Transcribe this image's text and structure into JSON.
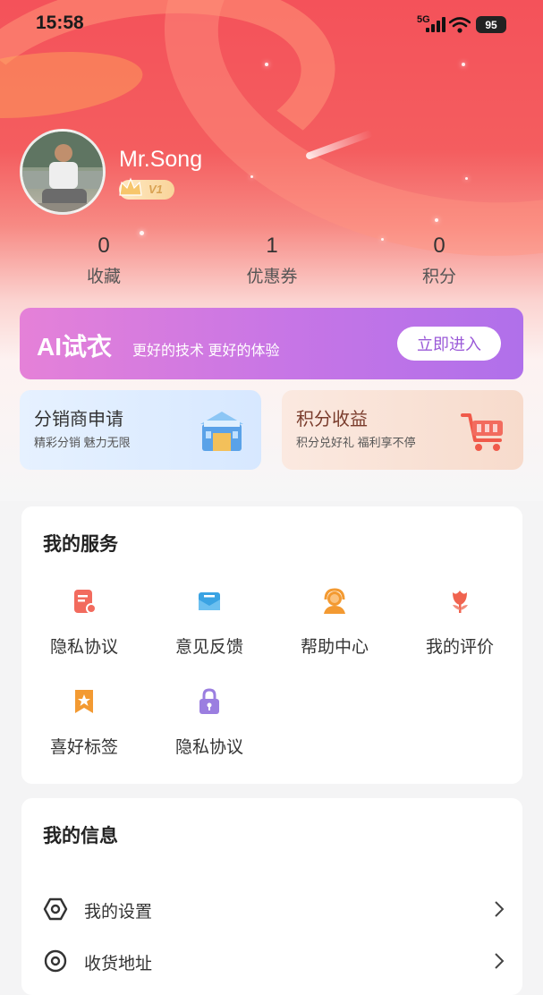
{
  "status_bar": {
    "time": "15:58",
    "network": "5G",
    "battery": "95"
  },
  "profile": {
    "name": "Mr.Song",
    "vip_label": "V1"
  },
  "stats": [
    {
      "value": "0",
      "label": "收藏"
    },
    {
      "value": "1",
      "label": "优惠券"
    },
    {
      "value": "0",
      "label": "积分"
    }
  ],
  "ai_banner": {
    "title": "AI试衣",
    "subtitle": "更好的技术 更好的体验",
    "button": "立即进入"
  },
  "promo_cards": [
    {
      "title": "分销商申请",
      "subtitle": "精彩分销 魅力无限"
    },
    {
      "title": "积分收益",
      "subtitle": "积分兑好礼 福利享不停"
    }
  ],
  "services": {
    "title": "我的服务",
    "items": [
      {
        "label": "隐私协议",
        "icon": "document-icon",
        "color": "#f26b5e"
      },
      {
        "label": "意见反馈",
        "icon": "mail-icon",
        "color": "#3aa3e3"
      },
      {
        "label": "帮助中心",
        "icon": "headset-icon",
        "color": "#f39a32"
      },
      {
        "label": "我的评价",
        "icon": "flower-icon",
        "color": "#f0634f"
      },
      {
        "label": "喜好标签",
        "icon": "bookmark-icon",
        "color": "#f39a32"
      },
      {
        "label": "隐私协议",
        "icon": "lock-icon",
        "color": "#9b7ee0"
      }
    ]
  },
  "info": {
    "title": "我的信息",
    "items": [
      {
        "label": "我的设置",
        "icon": "settings-icon"
      },
      {
        "label": "收货地址",
        "icon": "location-icon"
      }
    ]
  },
  "colors": {
    "accent": "#f4525a",
    "ai_gradient_start": "#e581d8",
    "ai_gradient_end": "#b070ea",
    "ai_button_text": "#9b5bd8"
  }
}
